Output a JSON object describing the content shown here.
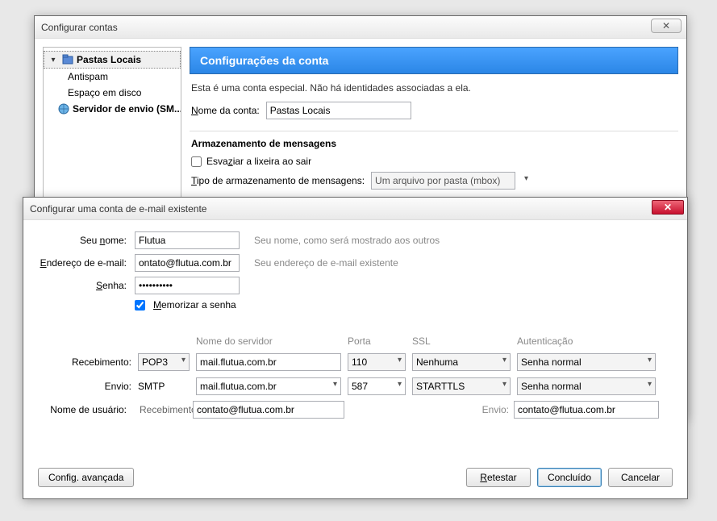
{
  "mainWindow": {
    "title": "Configurar contas",
    "tree": {
      "root": "Pastas Locais",
      "children": [
        "Antispam",
        "Espaço em disco"
      ],
      "smtp": "Servidor de envio (SM..."
    },
    "section": {
      "header": "Configurações da conta",
      "desc": "Esta é uma conta especial. Não há identidades associadas a ela.",
      "accountNameLabel": "Nome da conta:",
      "accountName": "Pastas Locais",
      "storageGroup": "Armazenamento de mensagens",
      "emptyTrash": "Esvaziar a lixeira ao sair",
      "storageTypeLabel": "Tipo de armazenamento de mensagens:",
      "storageType": "Um arquivo por pasta (mbox)"
    }
  },
  "subWindow": {
    "title": "Configurar uma conta de e-mail existente",
    "labels": {
      "name": "Seu nome:",
      "email": "Endereço de e-mail:",
      "password": "Senha:",
      "remember": "Memorizar a senha"
    },
    "hints": {
      "name": "Seu nome, como será mostrado aos outros",
      "email": "Seu endereço de e-mail existente"
    },
    "values": {
      "name": "Flutua",
      "email": "ontato@flutua.com.br",
      "password": "••••••••••",
      "rememberChecked": true
    },
    "columns": {
      "server": "Nome do servidor",
      "port": "Porta",
      "ssl": "SSL",
      "auth": "Autenticação"
    },
    "rows": {
      "incomingLabel": "Recebimento:",
      "outgoingLabel": "Envio:",
      "usernameLabel": "Nome de usuário:",
      "incoming": {
        "proto": "POP3",
        "server": "mail.flutua.com.br",
        "port": "110",
        "ssl": "Nenhuma",
        "auth": "Senha normal"
      },
      "outgoing": {
        "proto": "SMTP",
        "server": "mail.flutua.com.br",
        "port": "587",
        "ssl": "STARTTLS",
        "auth": "Senha normal"
      },
      "userIncomingLabel": "Recebimento:",
      "userIncoming": "contato@flutua.com.br",
      "userOutgoingLabel": "Envio:",
      "userOutgoing": "contato@flutua.com.br"
    },
    "buttons": {
      "advanced": "Config. avançada",
      "retest": "Retestar",
      "done": "Concluído",
      "cancel": "Cancelar"
    }
  }
}
